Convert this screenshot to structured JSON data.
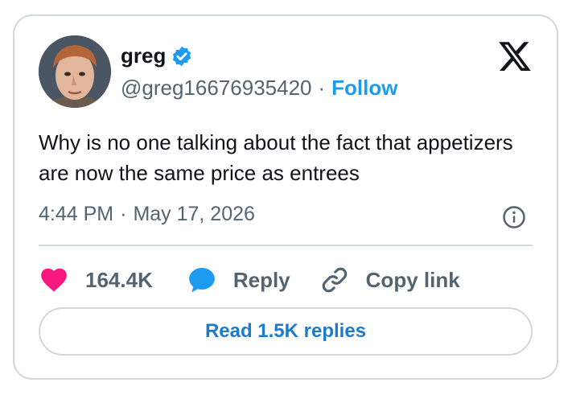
{
  "user": {
    "name": "greg",
    "handle": "@greg16676935420",
    "follow_label": "Follow",
    "separator": "·"
  },
  "tweet": {
    "text": "Why is no one talking about the fact that appetizers are now the same price as entrees",
    "time": "4:44 PM",
    "date": "May 17, 2026"
  },
  "actions": {
    "likes": "164.4K",
    "reply_label": "Reply",
    "copy_label": "Copy link"
  },
  "read_replies_label": "Read 1.5K replies",
  "icons": {
    "verified": "verified-badge-icon",
    "logo": "x-logo-icon",
    "info": "info-icon",
    "heart": "heart-icon",
    "reply": "reply-bubble-icon",
    "link": "link-icon"
  },
  "colors": {
    "accent": "#1d9bf0",
    "heart": "#f91880",
    "border": "#cfd9de",
    "muted": "#536471"
  }
}
